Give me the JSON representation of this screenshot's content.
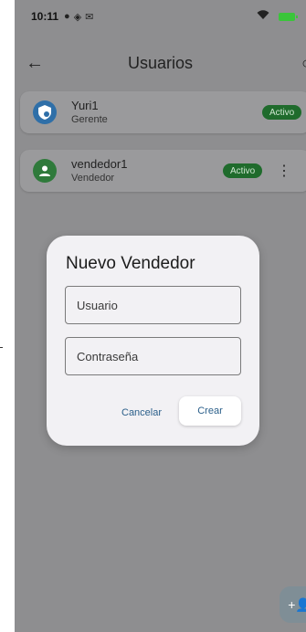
{
  "status_bar": {
    "time": "10:11"
  },
  "header": {
    "title": "Usuarios"
  },
  "users": [
    {
      "name": "Yuri1",
      "role": "Gerente",
      "badge": "Activo",
      "avatar_color": "#2f6fa8",
      "icon": "shield-account-icon"
    },
    {
      "name": "vendedor1",
      "role": "Vendedor",
      "badge": "Activo",
      "avatar_color": "#2f7a3b",
      "icon": "person-icon"
    }
  ],
  "dialog": {
    "title": "Nuevo Vendedor",
    "username_placeholder": "Usuario",
    "password_placeholder": "Contraseña",
    "cancel_label": "Cancelar",
    "create_label": "Crear"
  },
  "fab": {
    "icon": "person-add-icon"
  },
  "colors": {
    "badge_bg": "#1f6b2c",
    "accent": "#2b5f8a",
    "scrim": "#8e8e90"
  }
}
